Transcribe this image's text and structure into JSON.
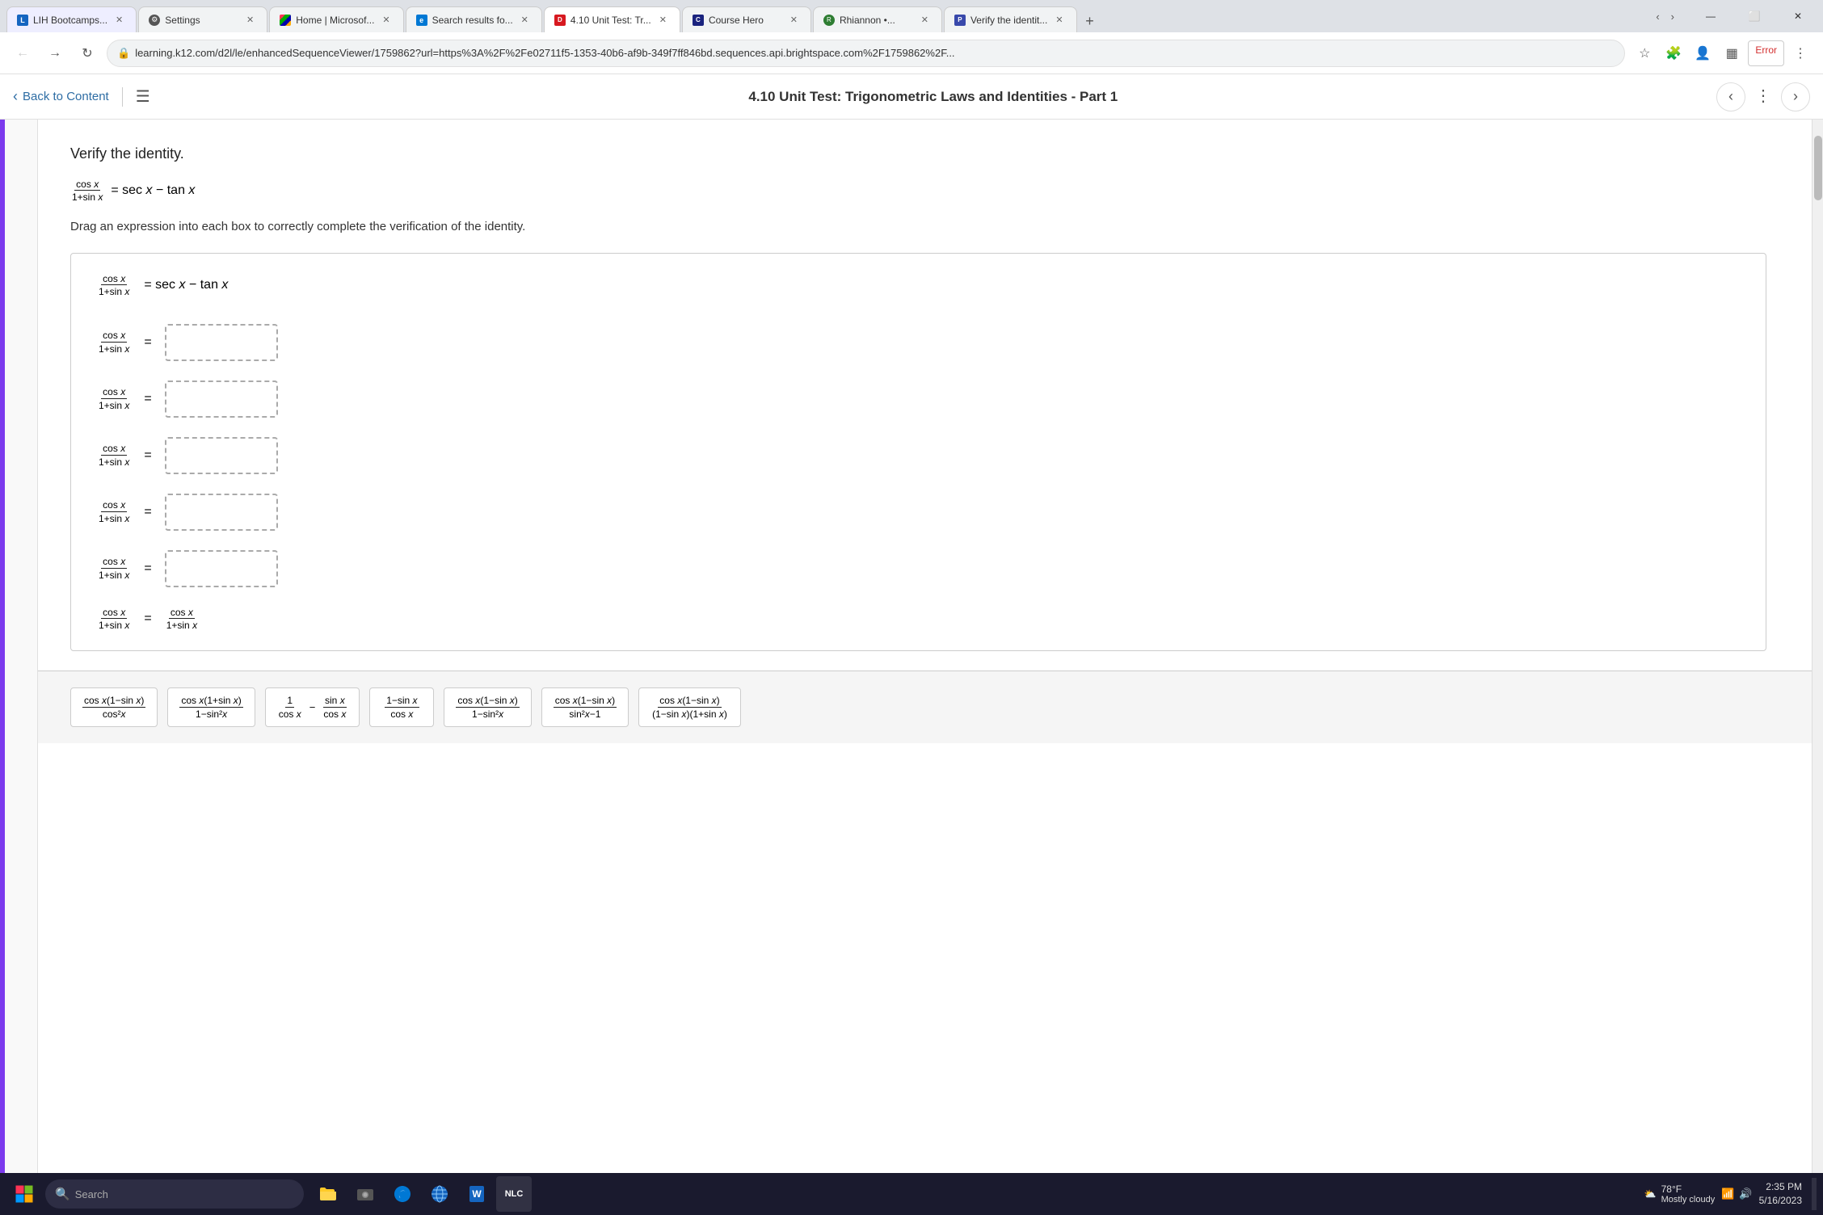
{
  "browser": {
    "tabs": [
      {
        "id": "tab1",
        "label": "LIH Bootcamps...",
        "favicon_color": "#1565c0",
        "active": false
      },
      {
        "id": "tab2",
        "label": "Settings",
        "favicon_color": "#555",
        "active": false
      },
      {
        "id": "tab3",
        "label": "Home | Microsof...",
        "favicon_color": "#0078d4",
        "active": false
      },
      {
        "id": "tab4",
        "label": "Search results fo...",
        "favicon_color": "#0078d4",
        "active": false
      },
      {
        "id": "tab5",
        "label": "4.10 Unit Test: Tr...",
        "favicon_color": "#d71920",
        "active": true
      },
      {
        "id": "tab6",
        "label": "Course Hero",
        "favicon_color": "#1a1a5e",
        "active": false
      },
      {
        "id": "tab7",
        "label": "Rhiannon •...",
        "favicon_color": "#2e7d32",
        "active": false
      },
      {
        "id": "tab8",
        "label": "Verify the identit...",
        "favicon_color": "#3949ab",
        "active": false
      }
    ],
    "address": "learning.k12.com/d2l/le/enhancedSequenceViewer/1759862?url=https%3A%2F%2Fe02711f5-1353-40b6-af9b-349f7ff846bd.sequences.api.brightspace.com%2F1759862%2F...",
    "error_label": "Error"
  },
  "app_header": {
    "back_label": "Back to Content",
    "title": "4.10 Unit Test: Trigonometric Laws and Identities - Part 1"
  },
  "question": {
    "title": "Verify the identity.",
    "identity_lhs_num": "cos x",
    "identity_lhs_den": "1+sin x",
    "identity_rhs": "= sec x − tan x",
    "instructions": "Drag an expression into each box to correctly complete the verification of the identity.",
    "steps": [
      {
        "lhs_num": "cos x",
        "lhs_den": "1+sin x",
        "rhs": "=",
        "has_box": true,
        "box_content": ""
      },
      {
        "lhs_num": "cos x",
        "lhs_den": "1+sin x",
        "rhs": "=",
        "has_box": true,
        "box_content": ""
      },
      {
        "lhs_num": "cos x",
        "lhs_den": "1+sin x",
        "rhs": "=",
        "has_box": true,
        "box_content": ""
      },
      {
        "lhs_num": "cos x",
        "lhs_den": "1+sin x",
        "rhs": "=",
        "has_box": true,
        "box_content": ""
      },
      {
        "lhs_num": "cos x",
        "lhs_den": "1+sin x",
        "rhs": "=",
        "has_box": true,
        "box_content": ""
      },
      {
        "lhs_num": "cos x",
        "lhs_den": "1+sin x",
        "rhs": "=",
        "final": true,
        "final_num": "cos x",
        "final_den": "1+sin x"
      }
    ],
    "answer_choices": [
      {
        "id": "a1",
        "type": "fraction",
        "num": "cos x(1−sin x)",
        "den": "cos²x"
      },
      {
        "id": "a2",
        "type": "fraction",
        "num": "cos x(1+sin x)",
        "den": "1−sin²x"
      },
      {
        "id": "a3",
        "type": "double_fraction",
        "parts": [
          "1/cos x",
          "sin x/cos x"
        ]
      },
      {
        "id": "a4",
        "type": "fraction",
        "num": "1−sin x",
        "den": "cos x"
      },
      {
        "id": "a5",
        "type": "fraction",
        "num": "cos x(1−sin x)",
        "den": "1−sin²x"
      },
      {
        "id": "a6",
        "type": "fraction",
        "num": "cos x(1−sin x)",
        "den": "sin²x−1"
      },
      {
        "id": "a7",
        "type": "fraction",
        "num": "cos x(1−sin x)",
        "den": "(1−sin x)(1+sin x)"
      }
    ]
  },
  "taskbar": {
    "search_placeholder": "Search",
    "time": "2:35 PM",
    "date": "5/16/2023",
    "weather_temp": "78°F",
    "weather_desc": "Mostly cloudy"
  }
}
